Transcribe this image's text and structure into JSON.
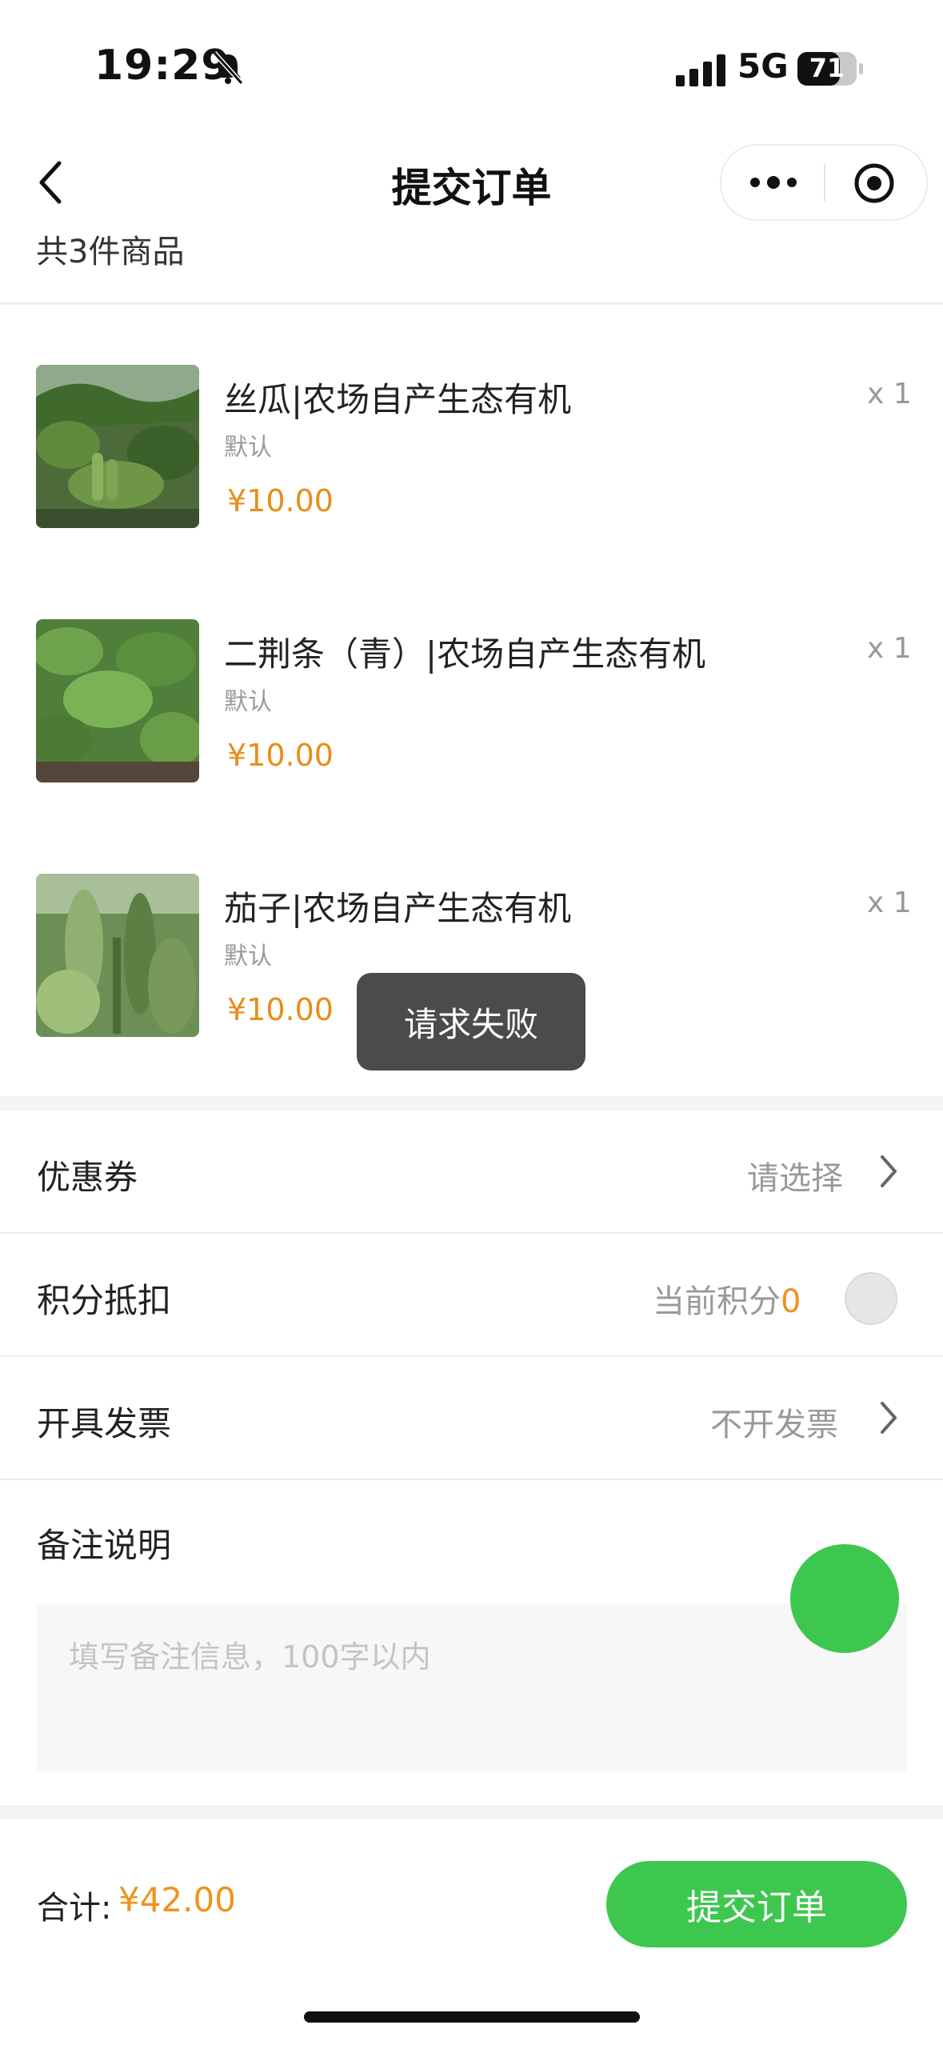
{
  "status_bar": {
    "time": "19:29",
    "network": "5G",
    "battery": "71"
  },
  "nav": {
    "title": "提交订单"
  },
  "order": {
    "count_text": "共3件商品"
  },
  "products": [
    {
      "name": "丝瓜|农场自产生态有机",
      "spec": "默认",
      "price": "¥10.00",
      "qty": "x 1",
      "image": "loofah-farm-photo"
    },
    {
      "name": "二荆条（青）|农场自产生态有机",
      "spec": "默认",
      "price": "¥10.00",
      "qty": "x 1",
      "image": "green-chili-farm-photo"
    },
    {
      "name": "茄子|农场自产生态有机",
      "spec": "默认",
      "price": "¥10.00",
      "qty": "x 1",
      "image": "eggplant-farm-photo"
    }
  ],
  "toast": {
    "text": "请求失败"
  },
  "coupon": {
    "label": "优惠券",
    "value": "请选择"
  },
  "points": {
    "label": "积分抵扣",
    "value_prefix": "当前积分",
    "value": "0"
  },
  "invoice": {
    "label": "开具发票",
    "value": "不开发票"
  },
  "remark": {
    "label": "备注说明",
    "placeholder": "填写备注信息，100字以内"
  },
  "footer": {
    "total_label": "合计:",
    "total_value": "¥42.00",
    "submit_label": "提交订单"
  },
  "colors": {
    "accent_green": "#3ec74f",
    "price_orange": "#e88d1d",
    "muted": "#999999"
  }
}
